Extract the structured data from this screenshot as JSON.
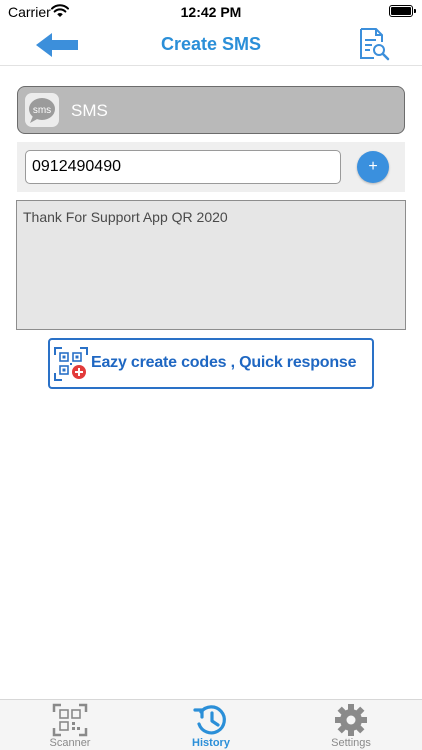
{
  "status_bar": {
    "carrier": "Carrier",
    "time": "12:42 PM"
  },
  "nav": {
    "title": "Create SMS",
    "back_icon": "arrow-left-icon",
    "right_icon": "search-document-icon"
  },
  "sms_card": {
    "icon_text": "sms",
    "label": "SMS"
  },
  "phone": {
    "value": "0912490490",
    "add_label": "+"
  },
  "message": {
    "value": "Thank For Support App QR 2020"
  },
  "banner": {
    "text": "Eazy create codes , Quick response"
  },
  "tabs": [
    {
      "label": "Scanner",
      "icon": "qr-scan-icon",
      "active": false
    },
    {
      "label": "History",
      "icon": "history-icon",
      "active": true
    },
    {
      "label": "Settings",
      "icon": "gear-icon",
      "active": false
    }
  ],
  "colors": {
    "accent": "#2b8fd8",
    "banner": "#1f67c2",
    "card": "#b9b9b9",
    "inactive_tab": "#8a8a8a"
  }
}
